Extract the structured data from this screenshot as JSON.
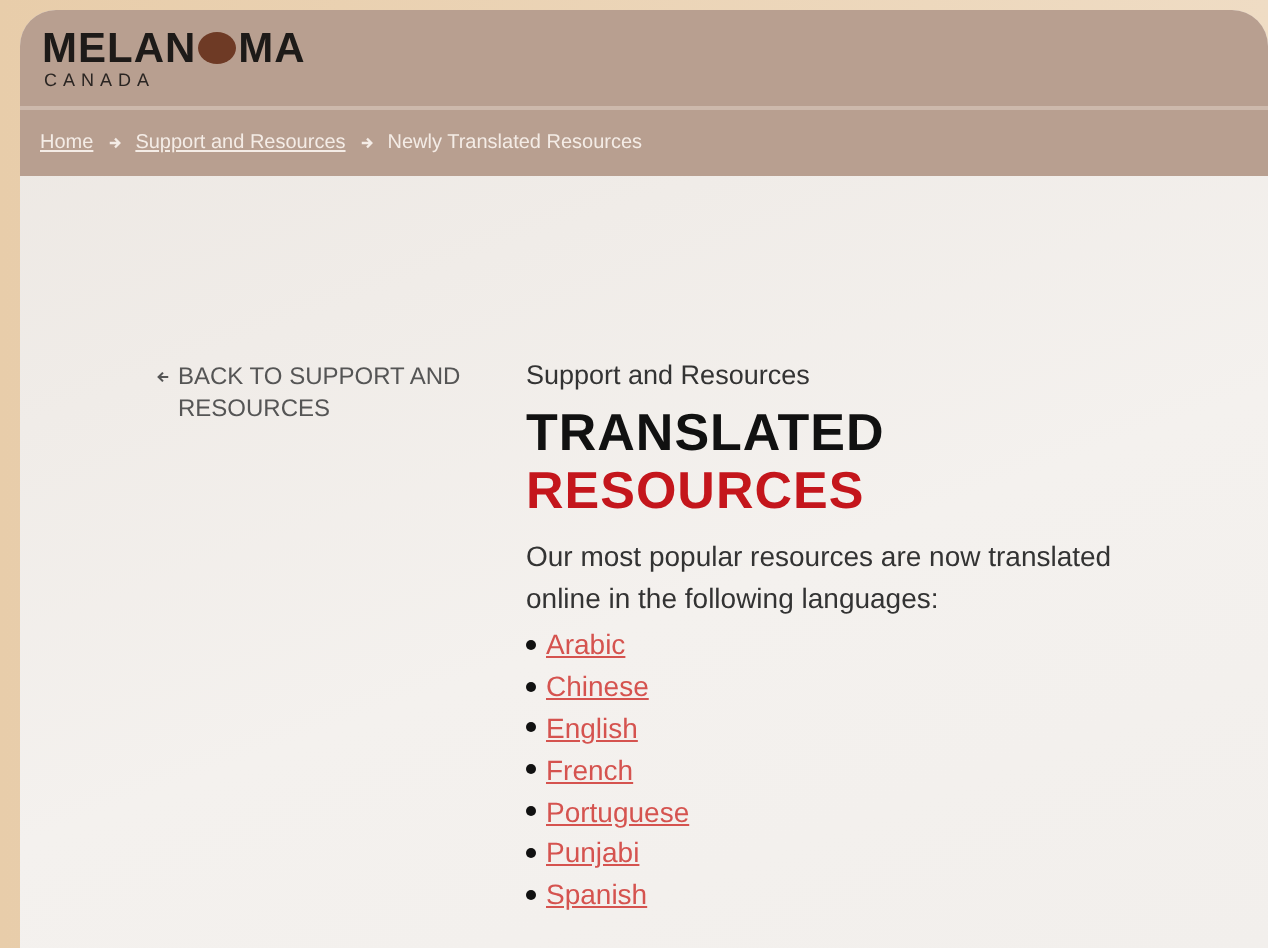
{
  "logo": {
    "before": "MELAN",
    "after": "MA",
    "subtitle": "CANADA"
  },
  "breadcrumb": [
    {
      "label": "Home",
      "link": true
    },
    {
      "label": "Support and Resources",
      "link": true
    },
    {
      "label": "Newly Translated Resources",
      "link": false
    }
  ],
  "back_link": "BACK TO SUPPORT AND RESOURCES",
  "eyebrow": "Support and Resources",
  "title": {
    "line_1": "TRANSLATED",
    "line_2": "RESOURCES"
  },
  "intro": "Our most popular resources are now translated online in the following languages:",
  "languages": [
    "Arabic",
    "Chinese",
    "English",
    "French",
    "Portuguese",
    "Punjabi",
    "Spanish"
  ]
}
